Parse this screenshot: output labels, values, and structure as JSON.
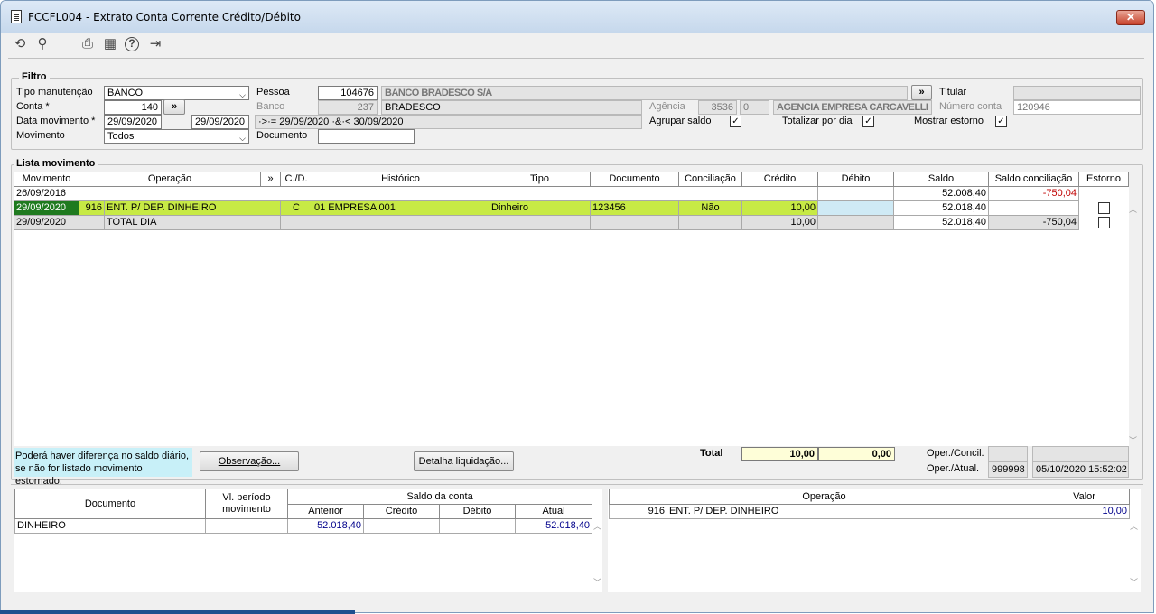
{
  "window": {
    "title": "FCCFL004 - Extrato Conta Corrente Crédito/Débito",
    "close": "✕"
  },
  "toolbar": {
    "undo": "⟲",
    "search": "⚲",
    "print": "⎙",
    "calendar": "▦",
    "help": "?",
    "exit": "⇥"
  },
  "filtro": {
    "title": "Filtro",
    "tipo_label": "Tipo manutenção",
    "tipo_value": "BANCO",
    "conta_label": "Conta *",
    "conta_value": "140",
    "conta_btn": "»",
    "data_label": "Data movimento *",
    "data_ini": "29/09/2020",
    "data_fim": "29/09/2020",
    "movimento_label": "Movimento",
    "movimento_value": "Todos",
    "pessoa_label": "Pessoa",
    "pessoa_value": "104676",
    "pessoa_nome": "BANCO BRADESCO S/A",
    "pessoa_btn": "»",
    "banco_label": "Banco",
    "banco_value": "237",
    "banco_nome": "BRADESCO",
    "periodo": "·>·= 29/09/2020 ·&·< 30/09/2020",
    "documento_label": "Documento",
    "documento_value": "",
    "agencia_label": "Agência",
    "agencia_value": "3536",
    "agencia_dv": "0",
    "agencia_nome": "AGENCIA EMPRESA CARCAVELLI",
    "agrupar_label": "Agrupar saldo",
    "totalizar_label": "Totalizar por dia",
    "estorno_label": "Mostrar estorno",
    "titular_label": "Titular",
    "titular_value": "",
    "numconta_label": "Número conta",
    "numconta_value": "120946"
  },
  "lista": {
    "title": "Lista movimento",
    "headers": [
      "Movimento",
      "Operação",
      "»",
      "C./D.",
      "Histórico",
      "Tipo",
      "Documento",
      "Conciliação",
      "Crédito",
      "Débito",
      "Saldo",
      "Saldo conciliação",
      "Estorno"
    ],
    "rows": [
      {
        "mov": "26/09/2016",
        "op_code": "",
        "op": "",
        "cd": "",
        "hist": "",
        "tipo": "",
        "doc": "",
        "conc": "",
        "cred": "",
        "deb": "",
        "saldo": "52.008,40",
        "saldo_conc": "-750,04"
      },
      {
        "mov": "29/09/2020",
        "op_code": "916",
        "op": "ENT. P/ DEP. DINHEIRO",
        "cd": "C",
        "hist": "01 EMPRESA 001",
        "tipo": "Dinheiro",
        "doc": "123456",
        "conc": "Não",
        "cred": "10,00",
        "deb": "",
        "saldo": "52.018,40",
        "saldo_conc": ""
      },
      {
        "mov": "29/09/2020",
        "op_code": "",
        "op": "TOTAL DIA",
        "cd": "",
        "hist": "",
        "tipo": "",
        "doc": "",
        "conc": "",
        "cred": "10,00",
        "deb": "",
        "saldo": "52.018,40",
        "saldo_conc": "-750,04"
      }
    ],
    "note_line1": "Poderá haver diferença no saldo diário,",
    "note_line2": "se não for listado movimento estornado.",
    "observacao_btn": "Observação...",
    "detalha_btn": "Detalha liquidação...",
    "total_label": "Total",
    "total_cred": "10,00",
    "total_deb": "0,00",
    "oper_concil_label": "Oper./Concil.",
    "oper_concil_value": "",
    "oper_concil_date": "",
    "oper_atual_label": "Oper./Atual.",
    "oper_atual_value": "999998",
    "oper_atual_date": "05/10/2020 15:52:02"
  },
  "bottom_left": {
    "h_documento": "Documento",
    "h_vl1": "Vl. período",
    "h_vl2": "movimento",
    "h_saldo": "Saldo da conta",
    "h_anterior": "Anterior",
    "h_credito": "Crédito",
    "h_debito": "Débito",
    "h_atual": "Atual",
    "row": {
      "doc": "DINHEIRO",
      "vl": "",
      "anterior": "52.018,40",
      "credito": "",
      "debito": "",
      "atual": "52.018,40"
    }
  },
  "bottom_right": {
    "h_operacao": "Operação",
    "h_valor": "Valor",
    "row": {
      "code": "916",
      "op": "ENT. P/ DEP. DINHEIRO",
      "valor": "10,00"
    }
  },
  "colors": {
    "selected_row": "#c7ea45",
    "highlight_cell": "#1f7a1f",
    "negative": "#c00000",
    "number_blue": "#00008b"
  }
}
